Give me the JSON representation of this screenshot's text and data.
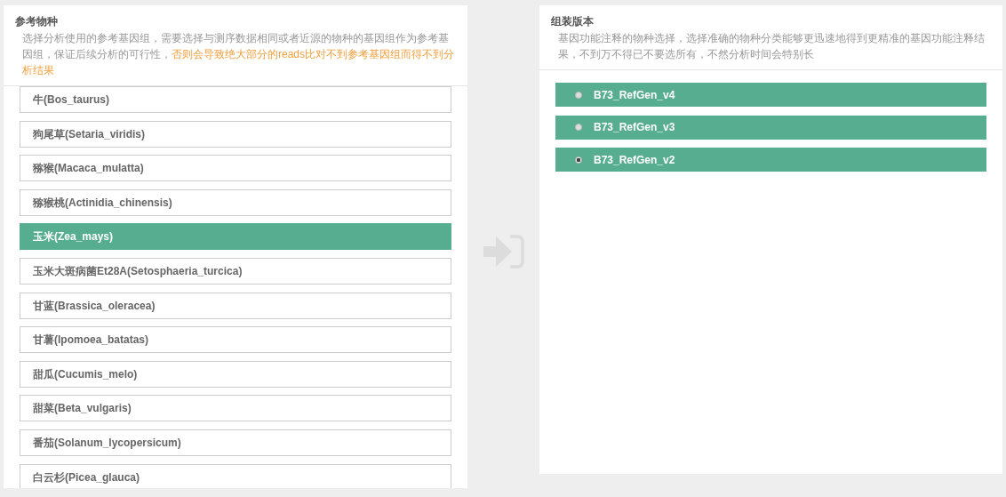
{
  "species_panel": {
    "title": "参考物种",
    "description": [
      {
        "kind": "normal",
        "text": "选择分析使用的参考基因组，需要选择与测序数据相同或者近源的物种的基因组作为参考基因组，保证后续分析的可行性，"
      },
      {
        "kind": "warning",
        "text": "否则会导致绝大部分的reads比对不到参考基因组而得不到分析结果"
      }
    ],
    "items": [
      {
        "label": "牛(Bos_taurus)",
        "selected": false
      },
      {
        "label": "狗尾草(Setaria_viridis)",
        "selected": false
      },
      {
        "label": "猕猴(Macaca_mulatta)",
        "selected": false
      },
      {
        "label": "猕猴桃(Actinidia_chinensis)",
        "selected": false
      },
      {
        "label": "玉米(Zea_mays)",
        "selected": true
      },
      {
        "label": "玉米大斑病菌Et28A(Setosphaeria_turcica)",
        "selected": false
      },
      {
        "label": "甘蓝(Brassica_oleracea)",
        "selected": false
      },
      {
        "label": "甘薯(Ipomoea_batatas)",
        "selected": false
      },
      {
        "label": "甜瓜(Cucumis_melo)",
        "selected": false
      },
      {
        "label": "甜菜(Beta_vulgaris)",
        "selected": false
      },
      {
        "label": "番茄(Solanum_lycopersicum)",
        "selected": false
      },
      {
        "label": "白云杉(Picea_glauca)",
        "selected": false
      }
    ]
  },
  "version_panel": {
    "title": "组装版本",
    "description": [
      {
        "kind": "normal",
        "text": "基因功能注释的物种选择，选择准确的物种分类能够更迅速地得到更精准的基因功能注释结果，不到万不得已不要选所有，不然分析时间会特别长"
      }
    ],
    "items": [
      {
        "label": "B73_RefGen_v4",
        "selected": false
      },
      {
        "label": "B73_RefGen_v3",
        "selected": false
      },
      {
        "label": "B73_RefGen_v2",
        "selected": true
      }
    ]
  }
}
